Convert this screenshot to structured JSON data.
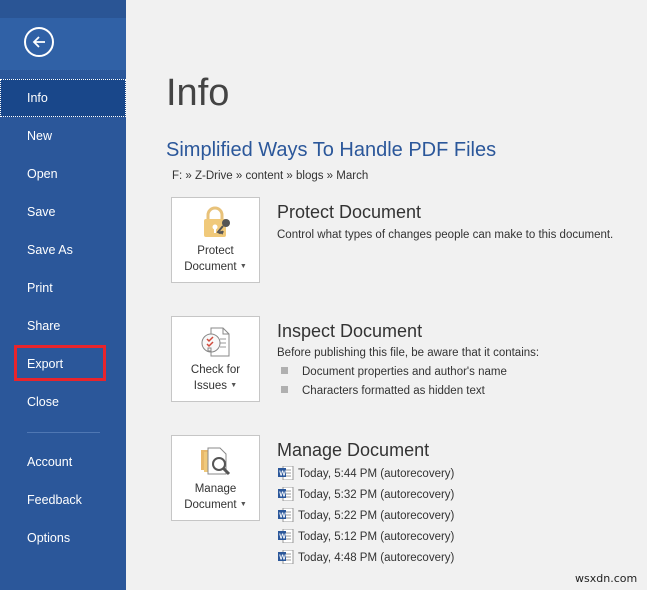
{
  "sidebar": {
    "back_label": "Back",
    "items": [
      {
        "label": "Info",
        "active": true
      },
      {
        "label": "New"
      },
      {
        "label": "Open"
      },
      {
        "label": "Save"
      },
      {
        "label": "Save As"
      },
      {
        "label": "Print"
      },
      {
        "label": "Share"
      },
      {
        "label": "Export",
        "highlighted": true
      },
      {
        "label": "Close"
      },
      {
        "label": "Account"
      },
      {
        "label": "Feedback"
      },
      {
        "label": "Options"
      }
    ]
  },
  "main": {
    "title": "Info",
    "document_title": "Simplified Ways To Handle PDF Files",
    "path": "F: » Z-Drive » content » blogs » March",
    "sections": [
      {
        "tile_line1": "Protect",
        "tile_line2": "Document",
        "title": "Protect Document",
        "description": "Control what types of changes people can make to this document."
      },
      {
        "tile_line1": "Check for",
        "tile_line2": "Issues",
        "title": "Inspect Document",
        "description": "Before publishing this file, be aware that it contains:",
        "bullets": [
          "Document properties and author's name",
          "Characters formatted as hidden text"
        ]
      },
      {
        "tile_line1": "Manage",
        "tile_line2": "Document",
        "title": "Manage Document",
        "versions": [
          "Today, 5:44 PM (autorecovery)",
          "Today, 5:32 PM (autorecovery)",
          "Today, 5:22 PM (autorecovery)",
          "Today, 5:12 PM (autorecovery)",
          "Today, 4:48 PM (autorecovery)"
        ]
      }
    ]
  },
  "colors": {
    "sidebar": "#2b579a",
    "active": "#19478a",
    "accent_title": "#2b579a",
    "highlight_box": "#e8242c"
  },
  "watermark": "wsxdn.com"
}
